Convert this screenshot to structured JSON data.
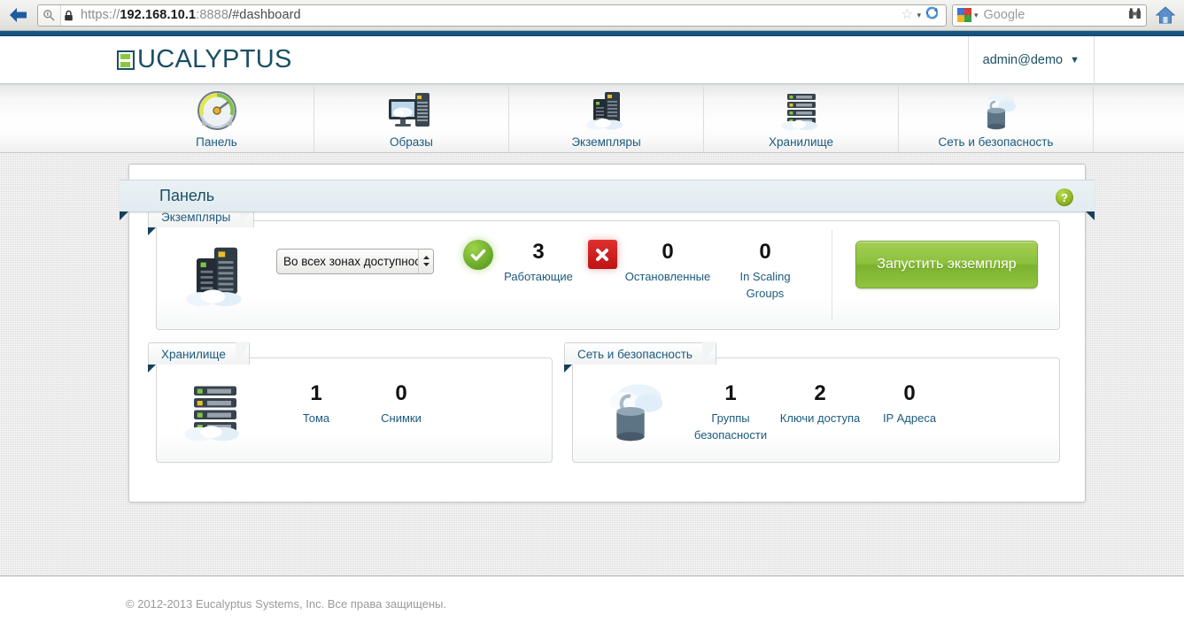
{
  "browser": {
    "back_icon": "back-arrow-icon",
    "identity_icon": "identity-magnifier-icon",
    "lock_icon": "padlock-icon",
    "url_scheme": "https://",
    "url_host": "192.168.10.1",
    "url_port": ":8888",
    "url_path": "/#dashboard",
    "bookmark_icon": "star-icon",
    "bookmark_caret": "▾",
    "reload_icon": "reload-icon",
    "search_engine_icon": "google-logo-icon",
    "search_caret": "▾",
    "search_placeholder": "Google",
    "search_value": "",
    "binoculars_icon": "binoculars-icon",
    "home_icon": "home-icon"
  },
  "header": {
    "logo_text": "UCALYPTUS",
    "logo_mark": "euca-e-icon",
    "user": "admin@demo",
    "user_caret": "▼"
  },
  "nav": {
    "items": [
      {
        "label": "Панель",
        "icon": "gauge-icon"
      },
      {
        "label": "Образы",
        "icon": "monitor-server-icon"
      },
      {
        "label": "Экземпляры",
        "icon": "servers-cloud-icon"
      },
      {
        "label": "Хранилище",
        "icon": "storage-racks-cloud-icon"
      },
      {
        "label": "Сеть и безопасность",
        "icon": "cloud-lock-icon"
      }
    ]
  },
  "page": {
    "title": "Панель",
    "help_icon_label": "?"
  },
  "instances": {
    "tab_label": "Экземпляры",
    "icon": "servers-cloud-icon",
    "zone_select_value": "Во всех зонах доступности",
    "select_arrows": "⌃⌄",
    "stats": [
      {
        "badge": "check-icon",
        "badge_glyph": "✔",
        "value": "3",
        "label": "Работающие"
      },
      {
        "badge": "cross-icon",
        "badge_glyph": "✖",
        "value": "0",
        "label": "Остановленные"
      },
      {
        "badge": "",
        "badge_glyph": "",
        "value": "0",
        "label": "In Scaling Groups"
      }
    ],
    "launch_button": "Запустить экземпляр"
  },
  "storage": {
    "tab_label": "Хранилище",
    "icon": "storage-racks-cloud-icon",
    "stats": [
      {
        "value": "1",
        "label": "Тома"
      },
      {
        "value": "0",
        "label": "Снимки"
      }
    ]
  },
  "network": {
    "tab_label": "Сеть и безопасность",
    "icon": "cloud-lock-icon",
    "stats": [
      {
        "value": "1",
        "label": "Группы безопасности"
      },
      {
        "value": "2",
        "label": "Ключи доступа"
      },
      {
        "value": "0",
        "label": "IP Адреса"
      }
    ]
  },
  "footer": {
    "copyright": "© 2012-2013 Eucalyptus Systems, Inc. Все права защищены."
  },
  "colors": {
    "brand_teal": "#1b4f63",
    "brand_green": "#8cc63e",
    "link_blue": "#1b5a7d",
    "status_ok": "#5d9e23",
    "status_bad": "#bf1212"
  }
}
